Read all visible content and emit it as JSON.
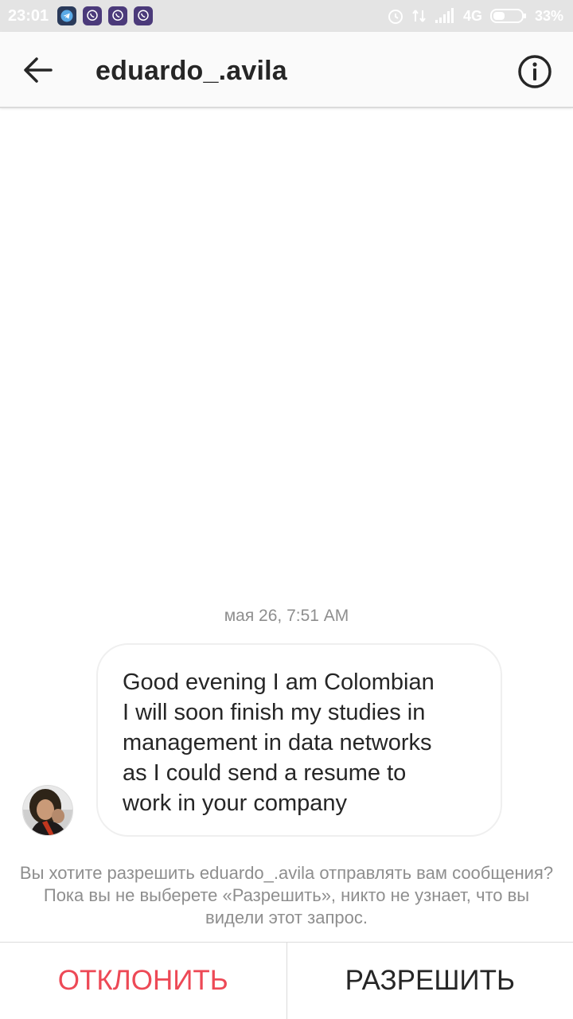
{
  "status_bar": {
    "time": "23:01",
    "network": "4G",
    "battery": "33%",
    "notifications": [
      "telegram-icon",
      "viber-icon",
      "viber-icon",
      "viber-icon"
    ]
  },
  "header": {
    "username": "eduardo_.avila",
    "back_icon": "arrow-left-icon",
    "info_icon": "info-circle-icon"
  },
  "chat": {
    "timestamp": "мая 26, 7:51 AM",
    "message": "Good evening I am Colombian\nI will soon finish my studies in\nmanagement in data networks\nas I could send a resume to\nwork in your company"
  },
  "request": {
    "notice": "Вы хотите разрешить eduardo_.avila отправлять вам сообщения? Пока вы не выберете «Разрешить», никто не узнает, что вы видели этот запрос.",
    "decline_label": "ОТКЛОНИТЬ",
    "allow_label": "РАЗРЕШИТЬ"
  },
  "colors": {
    "decline": "#ed4956",
    "text": "#262626",
    "muted": "#8e8e8e"
  }
}
